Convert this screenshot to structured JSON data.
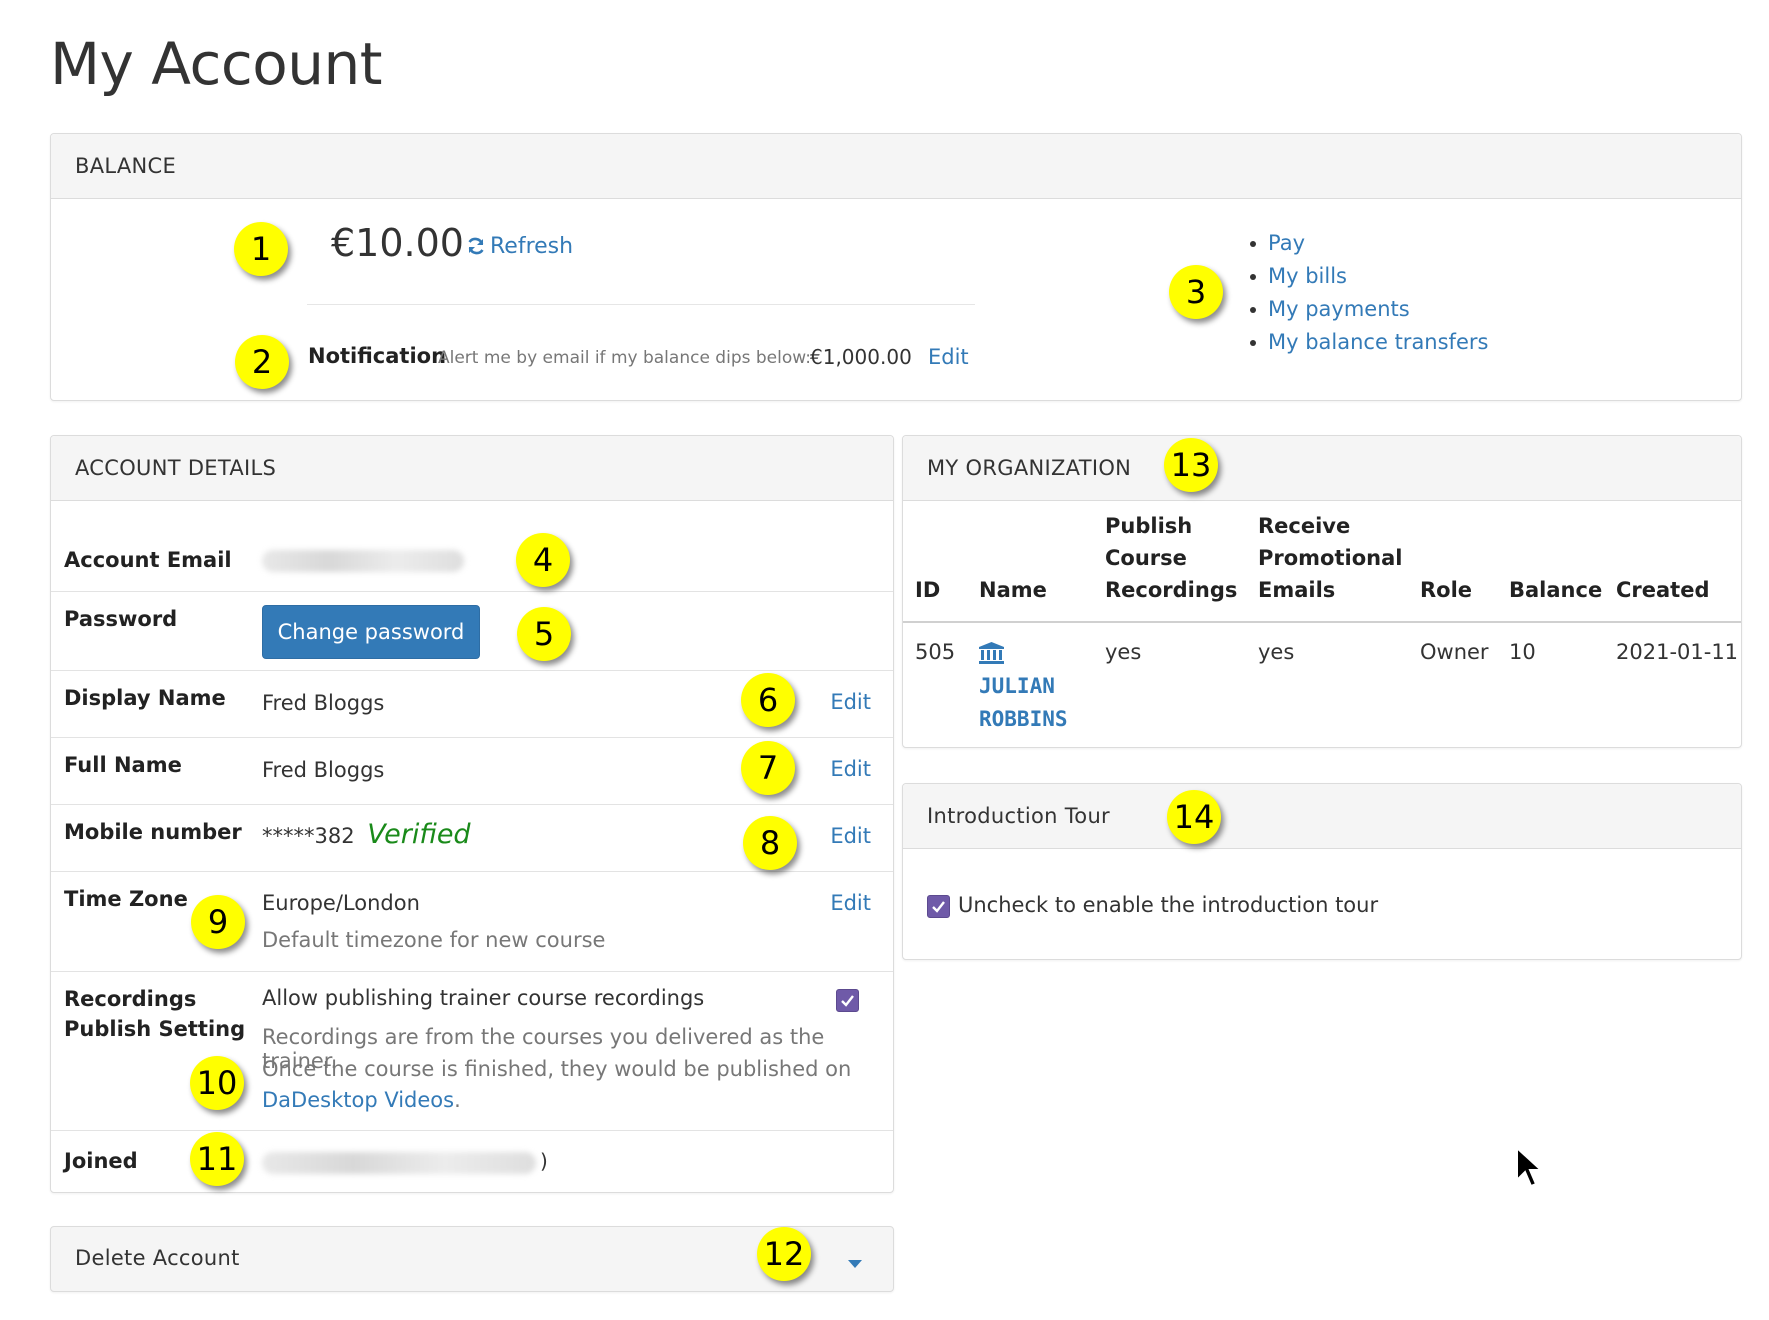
{
  "page": {
    "title": "My Account"
  },
  "balance": {
    "header": "BALANCE",
    "amount": "€10.00",
    "refresh_label": "Refresh",
    "notification_label": "Notification",
    "notification_text": "Alert me by email if my balance dips below:",
    "notification_amount": "€1,000.00",
    "edit_label": "Edit",
    "links": [
      "Pay",
      "My bills",
      "My payments",
      "My balance transfers"
    ]
  },
  "account_details": {
    "header": "ACCOUNT DETAILS",
    "email_label": "Account Email",
    "password_label": "Password",
    "change_password_label": "Change password",
    "display_name_label": "Display Name",
    "display_name": "Fred Bloggs",
    "full_name_label": "Full Name",
    "full_name": "Fred Bloggs",
    "mobile_label": "Mobile number",
    "mobile_value": "*****382",
    "mobile_status": "Verified",
    "timezone_label": "Time Zone",
    "timezone_value": "Europe/London",
    "timezone_help": "Default timezone for new course",
    "recordings_label_1": "Recordings",
    "recordings_label_2": "Publish Setting",
    "recordings_option": "Allow publishing trainer course recordings",
    "recordings_help_1": "Recordings are from the courses you delivered as the trainer.",
    "recordings_help_2": "Once the course is finished, they would be published on",
    "recordings_link": "DaDesktop Videos",
    "recordings_period": ".",
    "recordings_checked": true,
    "joined_label": "Joined",
    "joined_suffix": ")",
    "edit_label": "Edit"
  },
  "delete_account": {
    "header": "Delete Account"
  },
  "organization": {
    "header": "MY ORGANIZATION",
    "columns": {
      "id": "ID",
      "name": "Name",
      "publish_1": "Publish",
      "publish_2": "Course",
      "publish_3": "Recordings",
      "promo_1": "Receive",
      "promo_2": "Promotional",
      "promo_3": "Emails",
      "role": "Role",
      "balance": "Balance",
      "created": "Created"
    },
    "row": {
      "id": "505",
      "name_1": "JULIAN",
      "name_2": "ROBBINS",
      "publish": "yes",
      "promo": "yes",
      "role": "Owner",
      "balance": "10",
      "created": "2021-01-11"
    }
  },
  "intro_tour": {
    "header": "Introduction Tour",
    "checkbox_label": "Uncheck to enable the introduction tour",
    "checked": true
  },
  "callouts": [
    "1",
    "2",
    "3",
    "4",
    "5",
    "6",
    "7",
    "8",
    "9",
    "10",
    "11",
    "12",
    "13",
    "14"
  ],
  "colors": {
    "link": "#337ab7",
    "verified": "#1a8a1a",
    "callout": "#ffff00",
    "checkbox": "#6f5aa8"
  }
}
